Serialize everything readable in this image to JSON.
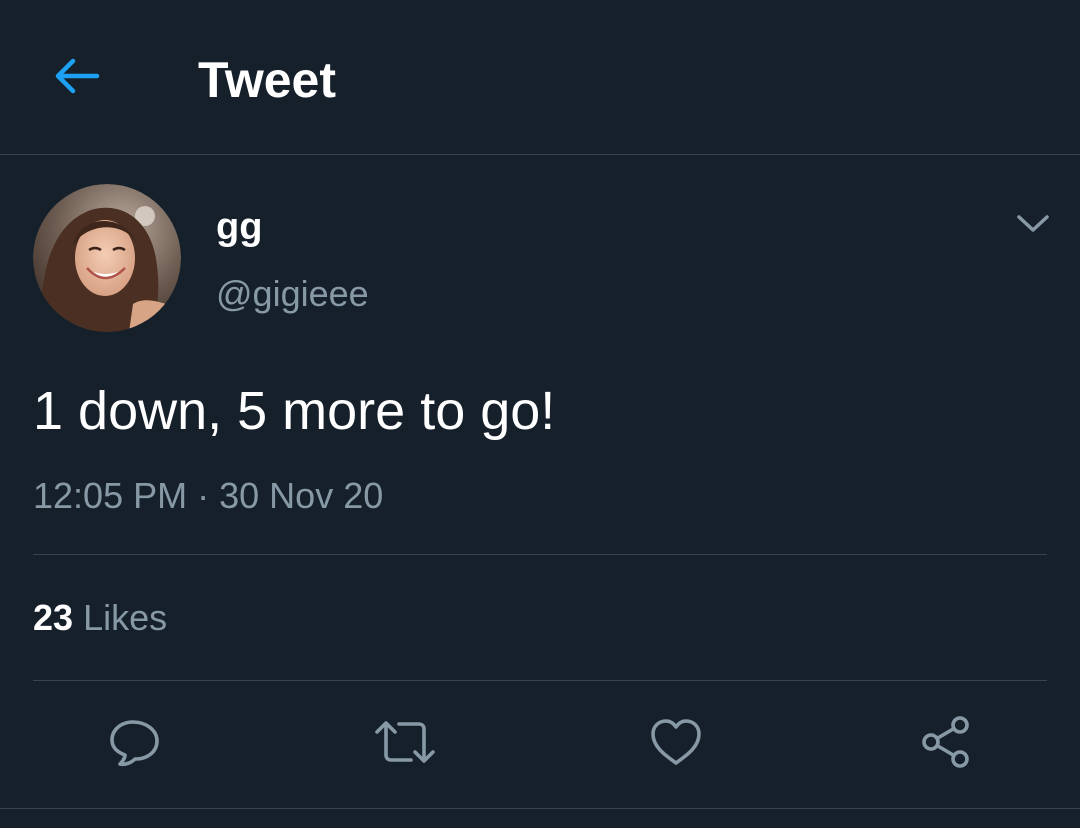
{
  "header": {
    "title": "Tweet",
    "back_icon": "arrow-left-icon"
  },
  "tweet": {
    "author": {
      "display_name": "gg",
      "handle": "@gigieee",
      "avatar_icon": "user-avatar-photo"
    },
    "text": "1 down, 5 more to go!",
    "time": "12:05 PM",
    "separator": "·",
    "date": "30 Nov 20",
    "likes_count": "23",
    "likes_label": "Likes"
  },
  "actions": [
    {
      "icon": "reply-icon"
    },
    {
      "icon": "retweet-icon"
    },
    {
      "icon": "like-icon"
    },
    {
      "icon": "share-icon"
    }
  ],
  "colors": {
    "background": "#15202b",
    "accent": "#1da1f2",
    "secondary_text": "#8899a6",
    "divider": "#38444d",
    "icon": "#8899a6"
  }
}
